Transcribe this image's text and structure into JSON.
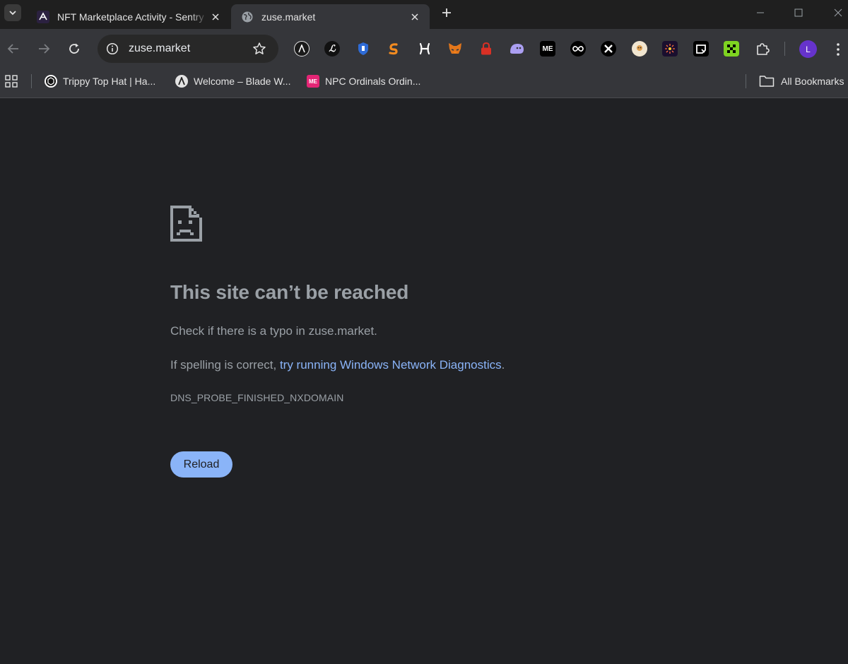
{
  "tabs": [
    {
      "title": "NFT Marketplace Activity - Sentry",
      "favicon": "sentry-logo-icon",
      "active": false
    },
    {
      "title": "zuse.market",
      "favicon": "globe-icon",
      "active": true
    }
  ],
  "toolbar": {
    "url": "zuse.market",
    "extensions": [
      "wallet-a-icon",
      "lace-icon",
      "vault-shield-icon",
      "s-swap-icon",
      "h-ext-icon",
      "metamask-fox-icon",
      "lock-icon",
      "ghost-icon",
      "magic-eden-icon",
      "infinity-icon",
      "x-cross-icon",
      "avatar-ext-icon",
      "sparkle-ext-icon",
      "q-ext-icon",
      "dice-icon",
      "puzzle-extensions-icon"
    ],
    "profile_initial": "L"
  },
  "bookmarks": {
    "items": [
      {
        "label": "Trippy Top Hat | Ha...",
        "icon": "hexagon-logo-icon"
      },
      {
        "label": "Welcome – Blade W...",
        "icon": "blade-logo-icon"
      },
      {
        "label": "NPC Ordinals Ordin...",
        "icon": "magic-eden-icon"
      }
    ],
    "all_label": "All Bookmarks"
  },
  "error": {
    "title": "This site can’t be reached",
    "line1": "Check if there is a typo in zuse.market.",
    "line2_prefix": "If spelling is correct, ",
    "line2_link": "try running Windows Network Diagnostics",
    "line2_suffix": ".",
    "code": "DNS_PROBE_FINISHED_NXDOMAIN",
    "reload_label": "Reload"
  },
  "colors": {
    "page_bg": "#202124",
    "text_muted": "#9aa0a6",
    "link": "#8ab4f8",
    "button_bg": "#8ab4f8"
  }
}
